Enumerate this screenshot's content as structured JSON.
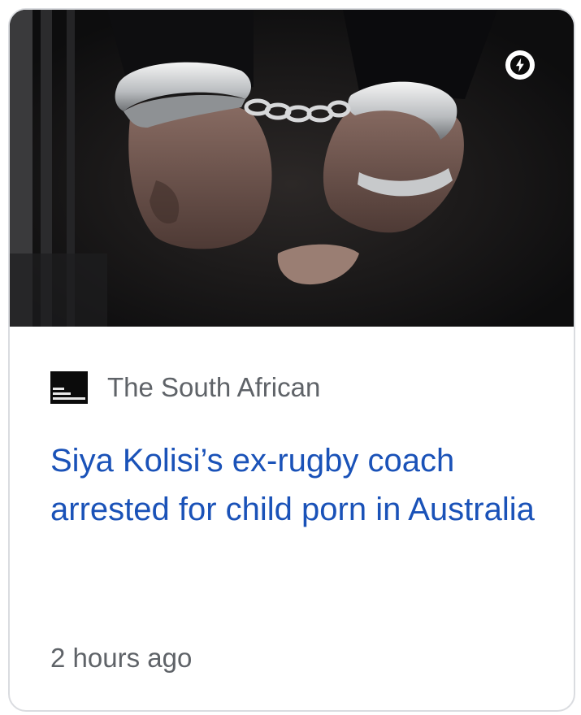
{
  "article": {
    "publisher": "The South African",
    "headline": "Siya Kolisi’s ex-rugby coach arrested for child porn in Australia",
    "timestamp": "2 hours ago",
    "thumbnail_icon": "amp-lightning-icon"
  },
  "colors": {
    "headline": "#1a52b8",
    "meta_text": "#5f6368",
    "card_border": "#dadce0"
  }
}
